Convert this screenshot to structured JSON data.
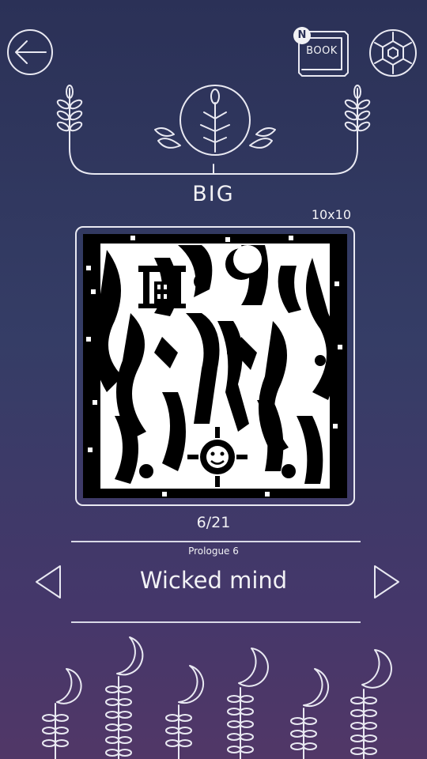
{
  "header": {
    "book_label": "BOOK",
    "book_badge": "N"
  },
  "puzzle": {
    "size_title": "BIG",
    "grid_size": "10x10",
    "progress": "6/21"
  },
  "level": {
    "chapter": "Prologue 6",
    "name": "Wicked mind"
  },
  "icons": {
    "back": "arrow-left-icon",
    "book": "book-icon",
    "settings": "hexagon-gear-icon",
    "prev": "triangle-left-icon",
    "next": "triangle-right-icon"
  },
  "colors": {
    "bg_top": "#2b3157",
    "bg_bottom": "#513767",
    "line": "#e9e9f2"
  }
}
